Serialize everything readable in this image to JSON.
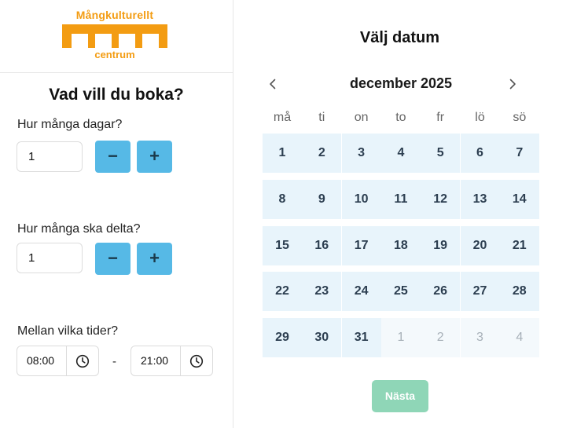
{
  "logo": {
    "top_text": "Mångkulturellt",
    "bottom_text": "centrum",
    "color": "#f39c12"
  },
  "booking": {
    "title": "Vad vill du boka?",
    "days": {
      "label": "Hur många dagar?",
      "value": "1",
      "minus": "−",
      "plus": "+"
    },
    "participants": {
      "label": "Hur många ska delta?",
      "value": "1",
      "minus": "−",
      "plus": "+"
    },
    "times": {
      "label": "Mellan vilka tider?",
      "from": "08:00",
      "separator": "-",
      "to": "21:00"
    }
  },
  "calendar": {
    "title": "Välj datum",
    "month": "december 2025",
    "prev": "‹",
    "next": "›",
    "weekdays": [
      "må",
      "ti",
      "on",
      "to",
      "fr",
      "lö",
      "sö"
    ],
    "weeks": [
      [
        "1",
        "2",
        "3",
        "4",
        "5",
        "6",
        "7"
      ],
      [
        "8",
        "9",
        "10",
        "11",
        "12",
        "13",
        "14"
      ],
      [
        "15",
        "16",
        "17",
        "18",
        "19",
        "20",
        "21"
      ],
      [
        "22",
        "23",
        "24",
        "25",
        "26",
        "27",
        "28"
      ],
      [
        "29",
        "30",
        "31",
        "1",
        "2",
        "3",
        "4"
      ]
    ],
    "other_month_start": 3
  },
  "next_button": {
    "label": "Nästa",
    "color": "#8fd6b7"
  },
  "accent": "#56b9e6"
}
